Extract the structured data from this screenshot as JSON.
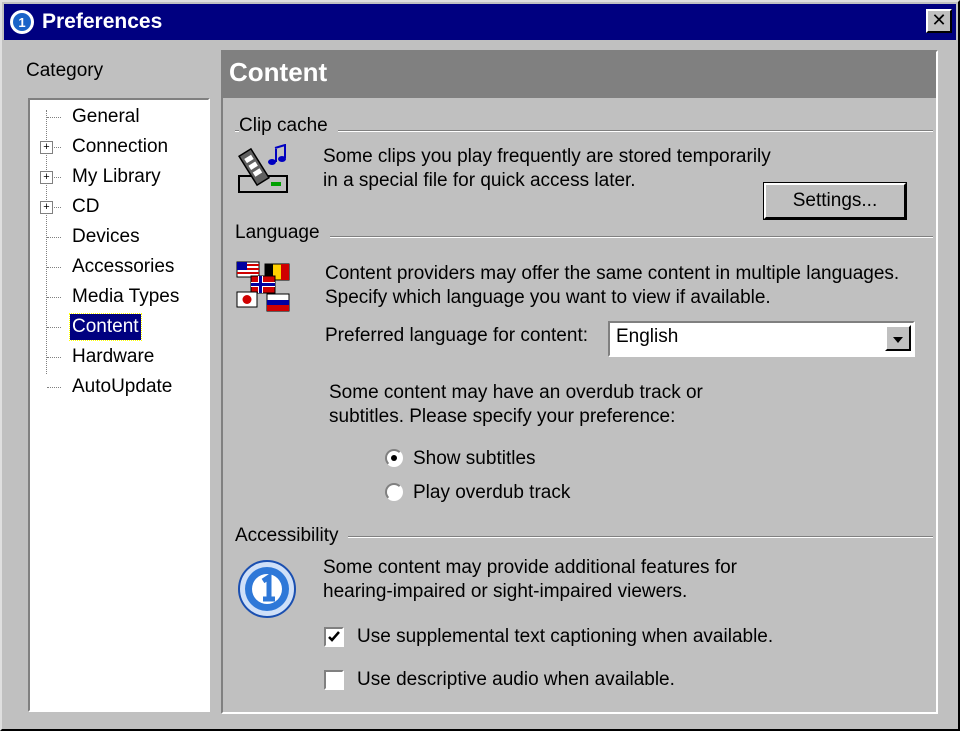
{
  "window": {
    "title": "Preferences"
  },
  "sidebar": {
    "label": "Category",
    "items": [
      {
        "label": "General",
        "expandable": false,
        "selected": false
      },
      {
        "label": "Connection",
        "expandable": true,
        "selected": false
      },
      {
        "label": "My Library",
        "expandable": true,
        "selected": false
      },
      {
        "label": "CD",
        "expandable": true,
        "selected": false
      },
      {
        "label": "Devices",
        "expandable": false,
        "selected": false
      },
      {
        "label": "Accessories",
        "expandable": false,
        "selected": false
      },
      {
        "label": "Media Types",
        "expandable": false,
        "selected": false
      },
      {
        "label": "Content",
        "expandable": false,
        "selected": true
      },
      {
        "label": "Hardware",
        "expandable": false,
        "selected": false
      },
      {
        "label": "AutoUpdate",
        "expandable": false,
        "selected": false
      }
    ]
  },
  "panel": {
    "title": "Content",
    "clip_cache": {
      "title": "Clip cache",
      "line1": "Some clips you play frequently are stored temporarily",
      "line2": "in a special file for quick access later.",
      "settings_button": "Settings..."
    },
    "language": {
      "title": "Language",
      "line1": "Content providers may offer the same content in multiple languages.",
      "line2": "Specify which language you want to view if available.",
      "preferred_label": "Preferred language for content:",
      "preferred_value": "English",
      "overdub_line1": "Some content may have an overdub track or",
      "overdub_line2": "subtitles.  Please specify your preference:",
      "radio_subtitles": "Show subtitles",
      "radio_overdub": "Play overdub track",
      "selected_option": "Show subtitles"
    },
    "accessibility": {
      "title": "Accessibility",
      "line1": "Some content may provide additional features for",
      "line2": "hearing-impaired or sight-impaired viewers.",
      "checkbox_captioning": "Use supplemental text captioning when available.",
      "checkbox_captioning_checked": true,
      "checkbox_audio": "Use descriptive audio when available.",
      "checkbox_audio_checked": false
    }
  },
  "colors": {
    "titlebar": "#000080",
    "face": "#c0c0c0",
    "header": "#808080",
    "selection": "#000080"
  },
  "icons": {
    "app": "realplayer-logo-icon",
    "close": "close-icon",
    "clip_cache": "film-music-drive-icon",
    "language": "flags-icon",
    "accessibility": "accessibility-logo-icon"
  }
}
